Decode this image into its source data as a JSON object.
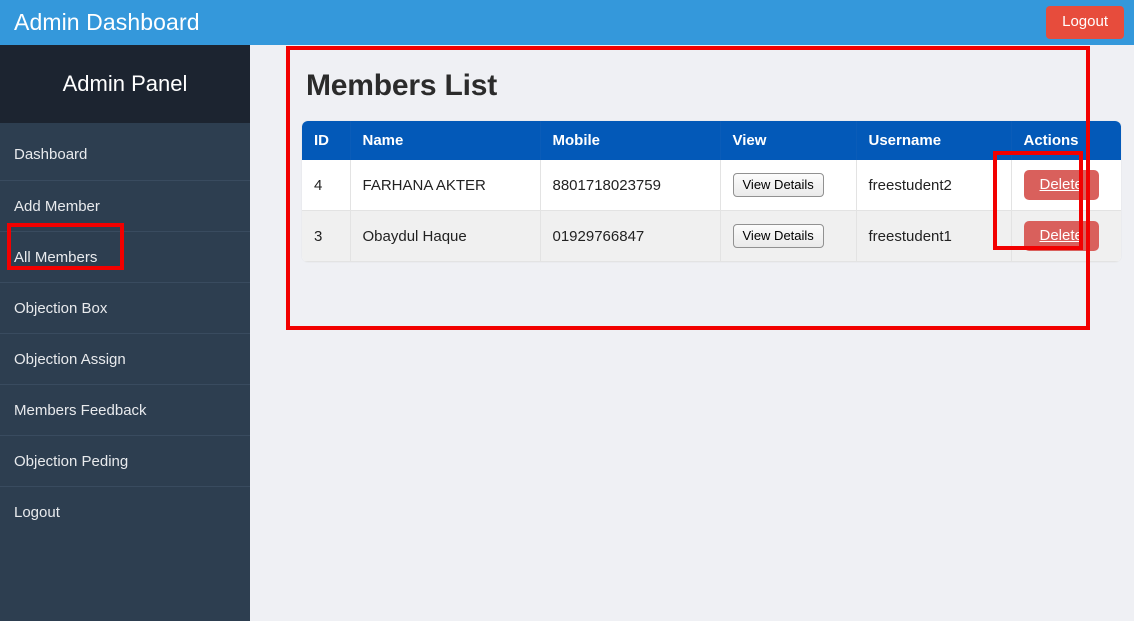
{
  "topbar": {
    "title": "Admin Dashboard",
    "logout_label": "Logout",
    "background_color": "#3498db",
    "logout_color": "#e74c3c"
  },
  "sidebar": {
    "header": "Admin Panel",
    "background_color": "#2d3e50",
    "header_background_color": "#1c2430",
    "items": [
      {
        "label": "Dashboard"
      },
      {
        "label": "Add Member"
      },
      {
        "label": "All Members"
      },
      {
        "label": "Objection Box"
      },
      {
        "label": "Objection Assign"
      },
      {
        "label": "Members Feedback"
      },
      {
        "label": "Objection Peding"
      },
      {
        "label": "Logout"
      }
    ],
    "active_item": "All Members"
  },
  "main": {
    "page_title": "Members List",
    "table": {
      "header_color": "#0359b8",
      "columns": [
        "ID",
        "Name",
        "Mobile",
        "View",
        "Username",
        "Actions"
      ],
      "rows": [
        {
          "id": "4",
          "name": "FARHANA AKTER",
          "mobile": "8801718023759",
          "view_label": "View Details",
          "username": "freestudent2",
          "action_label": "Delete"
        },
        {
          "id": "3",
          "name": "Obaydul Haque",
          "mobile": "01929766847",
          "view_label": "View Details",
          "username": "freestudent1",
          "action_label": "Delete"
        }
      ]
    }
  },
  "annotations": {
    "color": "#f20000",
    "boxes": [
      {
        "name": "all-members-menu-highlight"
      },
      {
        "name": "members-list-panel-highlight"
      },
      {
        "name": "delete-actions-column-highlight"
      }
    ]
  }
}
